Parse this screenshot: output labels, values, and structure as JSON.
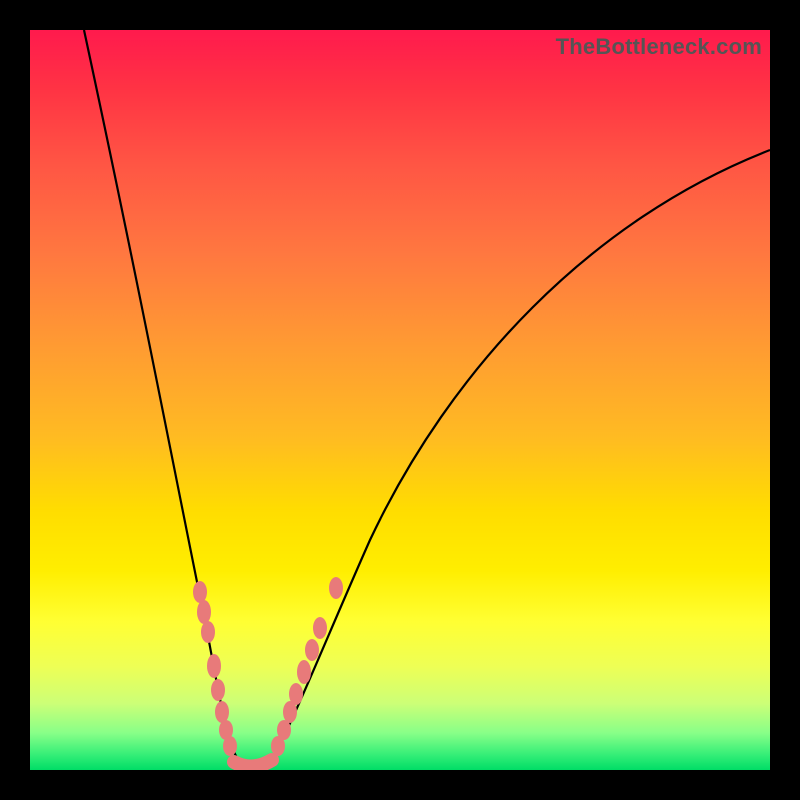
{
  "watermark": "TheBottleneck.com",
  "chart_data": {
    "type": "line",
    "title": "",
    "xlabel": "",
    "ylabel": "",
    "xlim": [
      0,
      100
    ],
    "ylim": [
      0,
      100
    ],
    "description": "Asymmetric V-shaped bottleneck curve over a vertical rainbow gradient (red top → green bottom). Minimum near x≈30. Pink oval markers cluster on both branches near the trough. No axes, ticks, or numeric labels are visible.",
    "series": [
      {
        "name": "bottleneck-curve",
        "x": [
          7,
          15,
          20,
          24,
          27,
          30,
          33,
          36,
          40,
          46,
          60,
          80,
          100
        ],
        "y": [
          100,
          65,
          40,
          20,
          8,
          0,
          6,
          18,
          32,
          50,
          70,
          82,
          86
        ]
      }
    ],
    "markers": {
      "name": "highlighted-points",
      "color": "#e87a7a",
      "x": [
        23.0,
        23.5,
        24.1,
        24.9,
        25.4,
        25.9,
        26.5,
        27.0,
        33.5,
        34.3,
        35.1,
        35.9,
        37.0,
        38.1,
        39.2,
        41.4
      ],
      "y": [
        24.1,
        21.4,
        18.6,
        14.1,
        10.8,
        7.8,
        5.4,
        3.2,
        3.2,
        5.4,
        7.8,
        10.3,
        13.2,
        16.2,
        19.2,
        24.6
      ]
    },
    "gradient_stops": [
      {
        "pos": 0.0,
        "color": "#ff1a4d"
      },
      {
        "pos": 0.3,
        "color": "#ff7740"
      },
      {
        "pos": 0.55,
        "color": "#ffbb22"
      },
      {
        "pos": 0.8,
        "color": "#ffff33"
      },
      {
        "pos": 1.0,
        "color": "#00dd66"
      }
    ]
  }
}
